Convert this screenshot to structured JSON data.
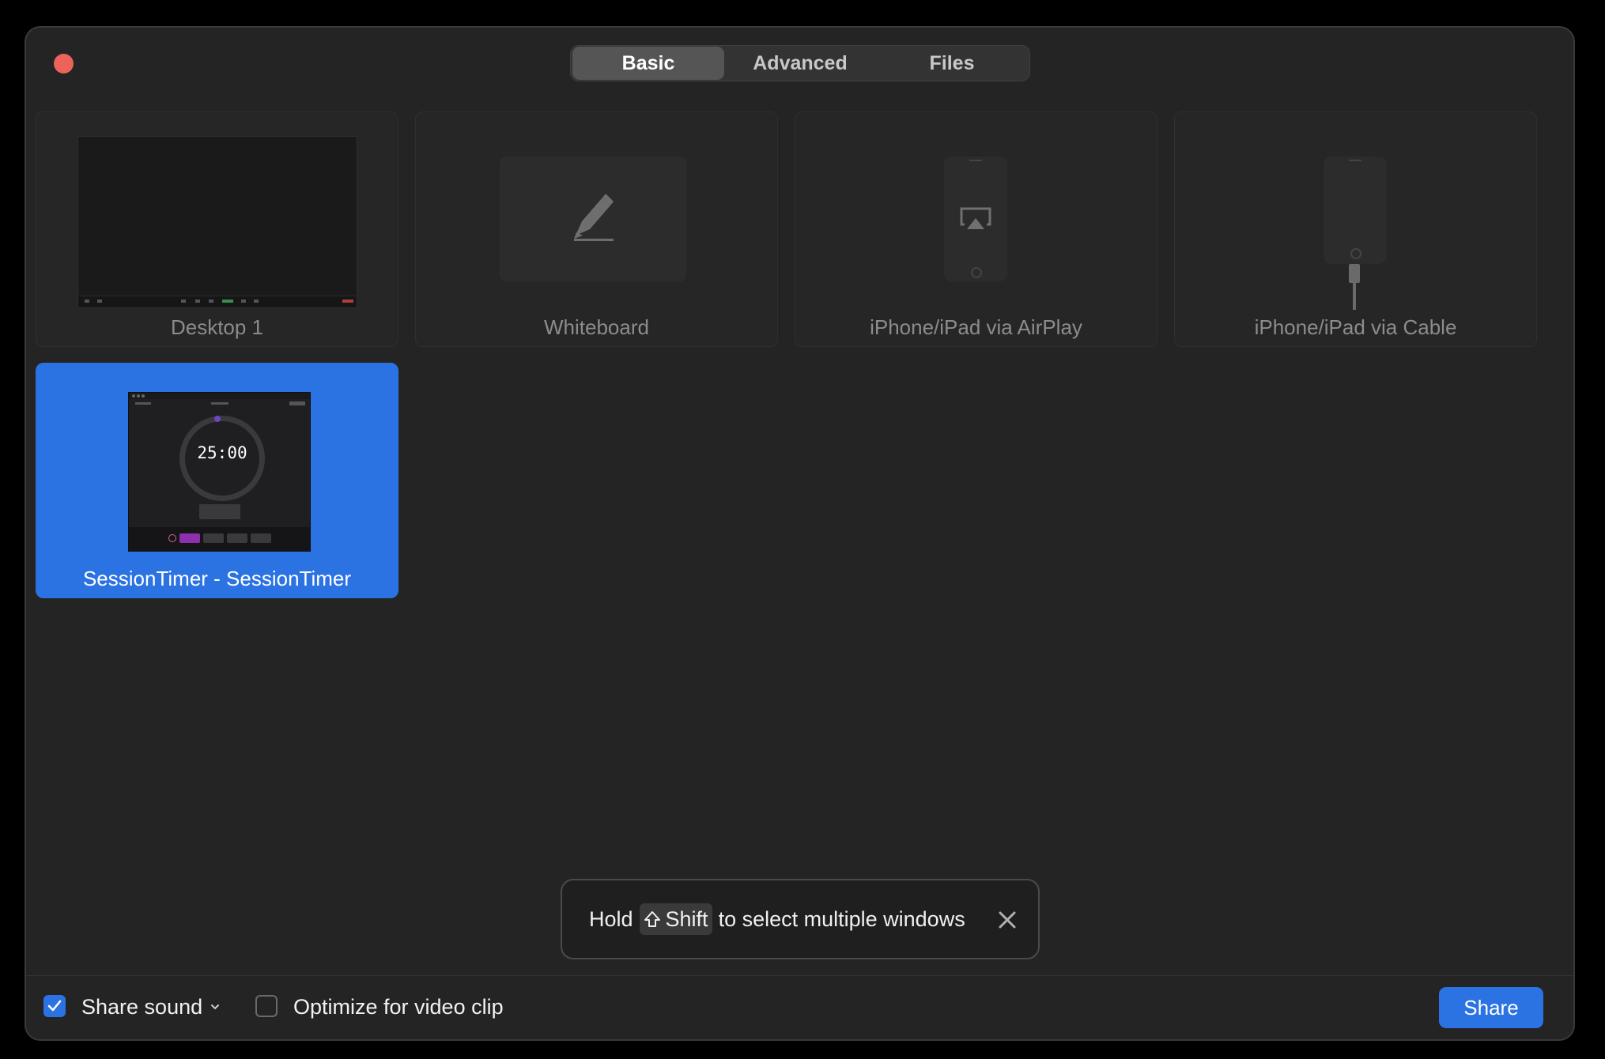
{
  "window": {
    "tabs": [
      {
        "label": "Basic",
        "active": true
      },
      {
        "label": "Advanced",
        "active": false
      },
      {
        "label": "Files",
        "active": false
      }
    ]
  },
  "tiles": [
    {
      "label": "Desktop 1",
      "icon": "desktop-preview"
    },
    {
      "label": "Whiteboard",
      "icon": "pencil-icon"
    },
    {
      "label": "iPhone/iPad via AirPlay",
      "icon": "airplay-icon"
    },
    {
      "label": "iPhone/iPad via Cable",
      "icon": "cable-icon"
    }
  ],
  "selected_window": {
    "label": "SessionTimer - SessionTimer",
    "preview_time": "25:00"
  },
  "toast": {
    "prefix": "Hold",
    "key_label": "Shift",
    "suffix": "to select multiple windows"
  },
  "bottom": {
    "share_sound_label": "Share sound",
    "share_sound_checked": true,
    "optimize_label": "Optimize for video clip",
    "optimize_checked": false,
    "share_button": "Share"
  },
  "colors": {
    "accent": "#2b73e3",
    "close": "#ec6459",
    "background": "#242424"
  }
}
